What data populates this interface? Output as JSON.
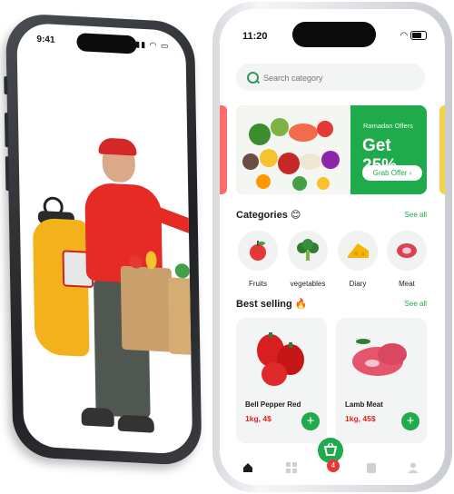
{
  "left_phone": {
    "time": "9:41"
  },
  "right_phone": {
    "time": "11:20",
    "search": {
      "placeholder": "Search category"
    },
    "banner": {
      "subtitle": "Ramadan Offers",
      "headline": "Get 25%",
      "button_label": "Grab Offer ›"
    },
    "categories": {
      "title": "Categories 😊",
      "see_all": "See all",
      "items": [
        {
          "label": "Fruits",
          "icon": "apple-icon"
        },
        {
          "label": "vegetables",
          "icon": "broccoli-icon"
        },
        {
          "label": "Diary",
          "icon": "cheese-icon"
        },
        {
          "label": "Meat",
          "icon": "meat-icon"
        }
      ]
    },
    "best_selling": {
      "title": "Best selling 🔥",
      "see_all": "See all",
      "items": [
        {
          "name": "Bell Pepper Red",
          "price": "1kg, 4$"
        },
        {
          "name": "Lamb Meat",
          "price": "1kg, 45$"
        }
      ]
    },
    "bottom_nav": {
      "cart_badge": "4",
      "items": [
        "home-icon",
        "grid-icon",
        "cart-icon",
        "clipboard-icon",
        "profile-icon"
      ]
    },
    "colors": {
      "accent": "#1faa4b",
      "price": "#e02424"
    }
  }
}
